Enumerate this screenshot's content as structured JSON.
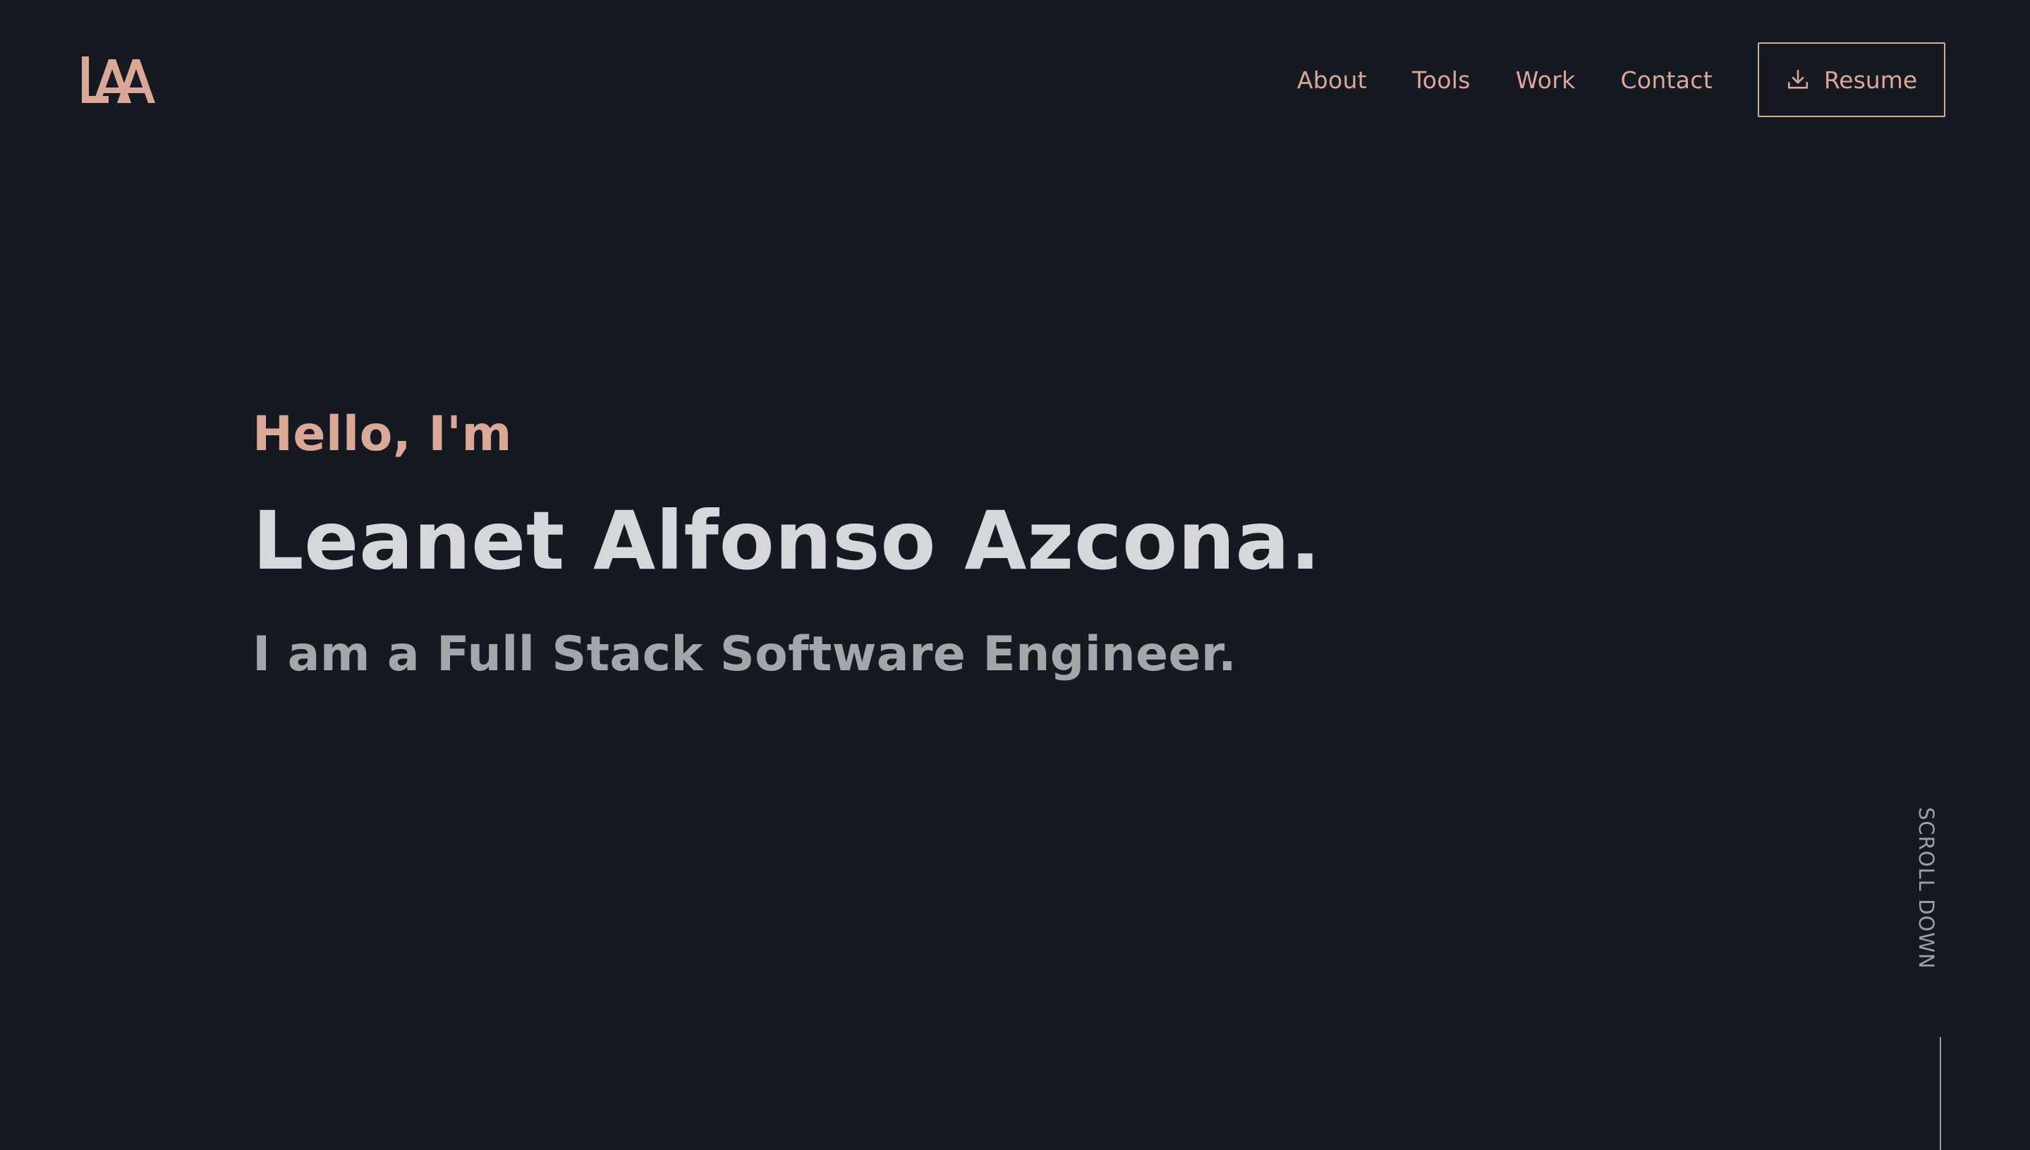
{
  "header": {
    "logo_text": "LAA",
    "nav": [
      {
        "label": "About"
      },
      {
        "label": "Tools"
      },
      {
        "label": "Work"
      },
      {
        "label": "Contact"
      }
    ],
    "resume_label": "Resume",
    "resume_icon": "download-icon"
  },
  "hero": {
    "greeting": "Hello, I'm",
    "name": "Leanet Alfonso Azcona.",
    "tagline": "I am a Full Stack Software Engineer."
  },
  "scroll": {
    "label": "SCROLL DOWN"
  },
  "colors": {
    "background": "#141922",
    "accent": "#dba896",
    "name": "#d6d7da",
    "tagline": "#a4a6aa",
    "muted": "#9ea0a5"
  }
}
